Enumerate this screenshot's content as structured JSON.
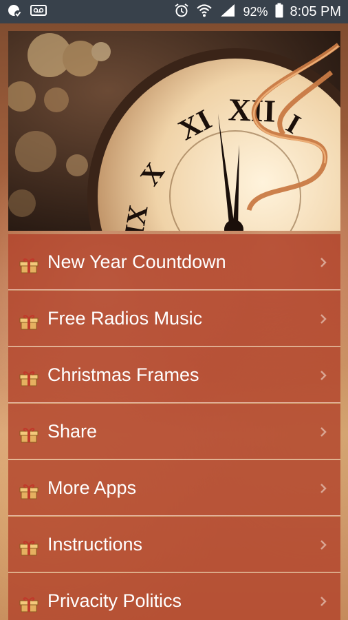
{
  "status_bar": {
    "battery_percent": "92%",
    "time": "8:05 PM",
    "icons": [
      "notification-icon",
      "voicemail-icon",
      "alarm-icon",
      "wifi-icon",
      "signal-icon",
      "battery-icon"
    ]
  },
  "header": {
    "image": "new-year-clock-image"
  },
  "menu": {
    "items": [
      {
        "label": "New Year Countdown",
        "icon": "gift-icon"
      },
      {
        "label": "Free Radios Music",
        "icon": "gift-icon"
      },
      {
        "label": "Christmas Frames",
        "icon": "gift-icon"
      },
      {
        "label": "Share",
        "icon": "gift-icon"
      },
      {
        "label": "More Apps",
        "icon": "gift-icon"
      },
      {
        "label": "Instructions",
        "icon": "gift-icon"
      },
      {
        "label": "Privacity Politics",
        "icon": "gift-icon"
      }
    ]
  },
  "colors": {
    "status_bar": "#38414b",
    "menu_item": "#b2422a",
    "menu_text": "#ffffff"
  }
}
